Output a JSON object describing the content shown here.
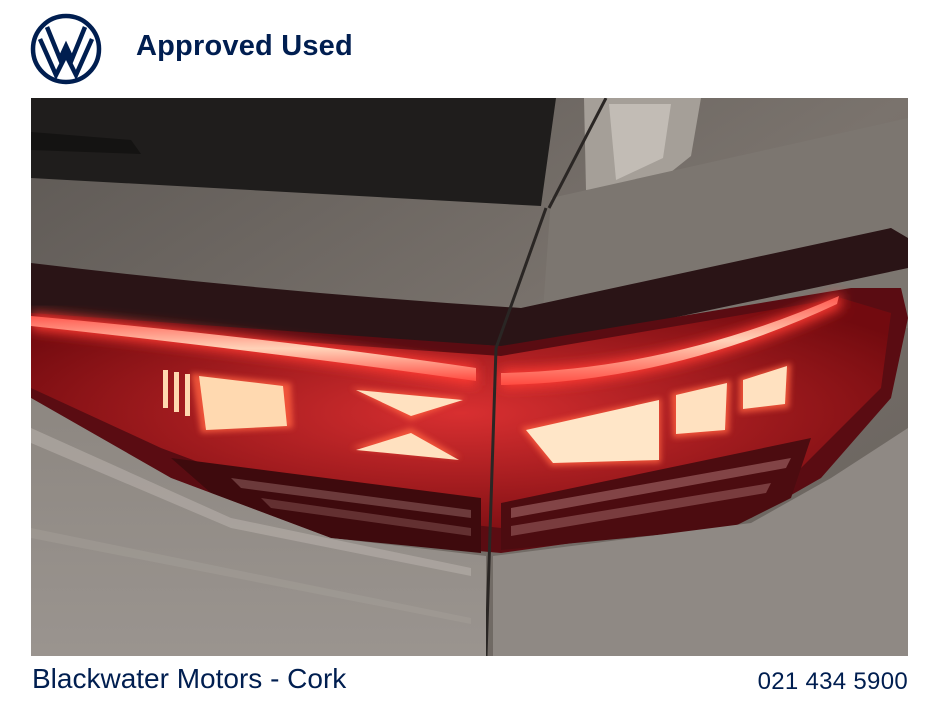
{
  "header": {
    "logo_icon": "volkswagen-logo-icon",
    "title": "Approved Used",
    "brand_color": "#001e50"
  },
  "photo": {
    "subject": "car-tail-light-image",
    "light_color": "#e8141c"
  },
  "footer": {
    "dealer": "Blackwater Motors - Cork",
    "phone": "021 434 5900"
  }
}
